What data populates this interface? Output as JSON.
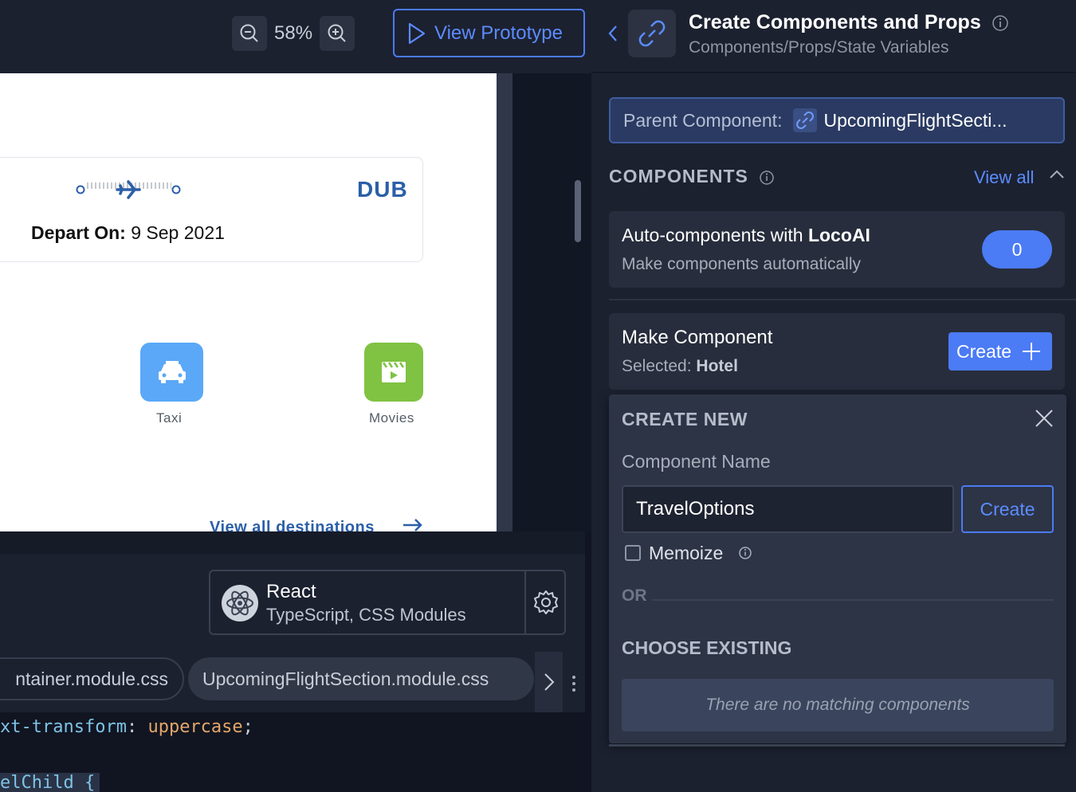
{
  "toolbar": {
    "zoom_level": "58%",
    "view_prototype_label": "View Prototype"
  },
  "canvas": {
    "flight": {
      "destination_code": "DUB",
      "depart_label": "Depart On:",
      "depart_date": "9 Sep 2021"
    },
    "tiles": [
      {
        "label": "Taxi",
        "icon": "taxi-icon",
        "color": "#5aa8f7"
      },
      {
        "label": "Movies",
        "icon": "movie-icon",
        "color": "#80c242"
      }
    ],
    "view_all_destinations": "View all destinations"
  },
  "framework": {
    "name": "React",
    "details": "TypeScript, CSS Modules"
  },
  "file_tabs": [
    {
      "label": "ntainer.module.css",
      "active": false
    },
    {
      "label": "UpcomingFlightSection.module.css",
      "active": true
    }
  ],
  "code": {
    "line1_prop": "xt-transform",
    "line1_sep": ": ",
    "line1_val": "uppercase",
    "line1_end": ";",
    "line2": "elChild {"
  },
  "panel": {
    "title": "Create Components and Props",
    "subtitle": "Components/Props/State Variables",
    "parent_label": "Parent Component:",
    "parent_value": "UpcomingFlightSecti...",
    "components_heading": "COMPONENTS",
    "view_all": "View all",
    "auto": {
      "title_prefix": "Auto-components with ",
      "title_brand": "LocoAI",
      "subtitle": "Make components automatically",
      "count": "0"
    },
    "make": {
      "title": "Make Component",
      "selected_label": "Selected:",
      "selected_value": "Hotel",
      "create_label": "Create"
    },
    "create_new": {
      "heading": "CREATE NEW",
      "name_label": "Component Name",
      "name_value": "TravelOptions",
      "create_label": "Create",
      "memoize_label": "Memoize",
      "memoize_checked": false,
      "or_label": "OR",
      "choose_heading": "CHOOSE EXISTING",
      "empty_message": "There are no matching components"
    }
  },
  "colors": {
    "accent": "#4b7bf5",
    "panel_bg": "#1c2130",
    "brand_blue": "#2b5fa8"
  }
}
